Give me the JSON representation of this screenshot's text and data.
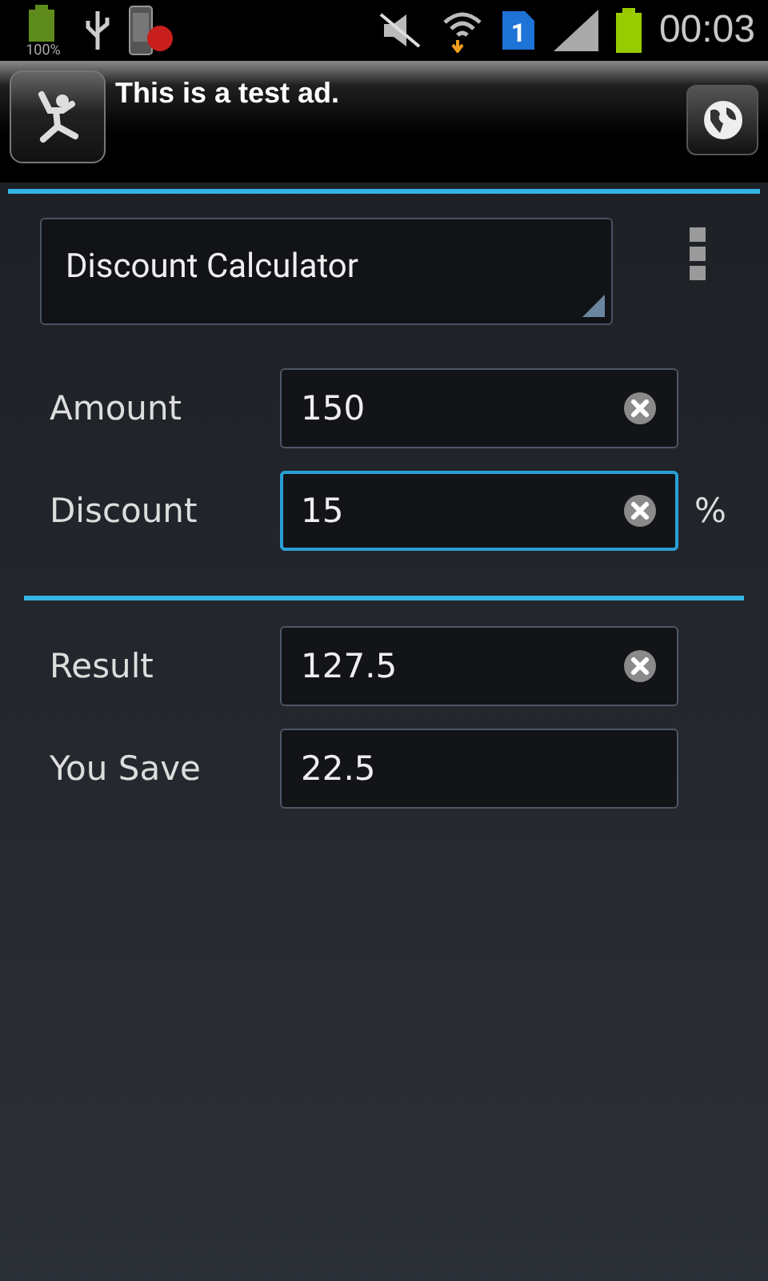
{
  "status_bar": {
    "battery_label": "100%",
    "sim_slot": "1",
    "time": "00:03"
  },
  "ad": {
    "text": "This is a test ad."
  },
  "calculator_select": {
    "value": "Discount Calculator"
  },
  "inputs": [
    {
      "label": "Amount",
      "value": "150",
      "focused": false,
      "clear_button": true
    },
    {
      "label": "Discount",
      "value": "15",
      "focused": true,
      "clear_button": true,
      "unit": "%"
    }
  ],
  "outputs": [
    {
      "label": "Result",
      "value": "127.5",
      "focused": false,
      "clear_button": true
    },
    {
      "label": "You Save",
      "value": "22.5",
      "focused": false,
      "clear_button": false
    }
  ]
}
